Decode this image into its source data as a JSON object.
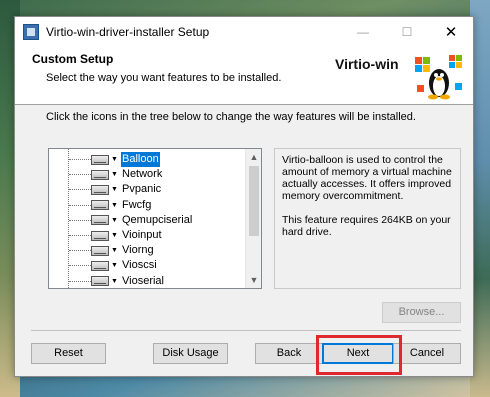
{
  "window": {
    "title": "Virtio-win-driver-installer Setup",
    "minimize_glyph": "—",
    "maximize_glyph": "☐",
    "close_glyph": "✕"
  },
  "header": {
    "title": "Custom Setup",
    "subtitle": "Select the way you want features to be installed.",
    "brand": "Virtio-win"
  },
  "instruction": "Click the icons in the tree below to change the way features will be installed.",
  "features": [
    {
      "label": "Balloon",
      "selected": true
    },
    {
      "label": "Network",
      "selected": false
    },
    {
      "label": "Pvpanic",
      "selected": false
    },
    {
      "label": "Fwcfg",
      "selected": false
    },
    {
      "label": "Qemupciserial",
      "selected": false
    },
    {
      "label": "Vioinput",
      "selected": false
    },
    {
      "label": "Viorng",
      "selected": false
    },
    {
      "label": "Vioscsi",
      "selected": false
    },
    {
      "label": "Vioserial",
      "selected": false
    }
  ],
  "description": {
    "text": "Virtio-balloon is used to control the amount of memory a virtual machine actually accesses. It offers improved memory overcommitment.",
    "size_note": "This feature requires 264KB on your hard drive."
  },
  "buttons": {
    "browse": "Browse...",
    "reset": "Reset",
    "disk_usage": "Disk Usage",
    "back": "Back",
    "next": "Next",
    "cancel": "Cancel"
  },
  "icons": {
    "app": "installer-icon",
    "feature": "drive-icon",
    "logo": "windows-tux-logo"
  },
  "colors": {
    "selection": "#0078d7",
    "highlight_box": "#e0282e"
  }
}
